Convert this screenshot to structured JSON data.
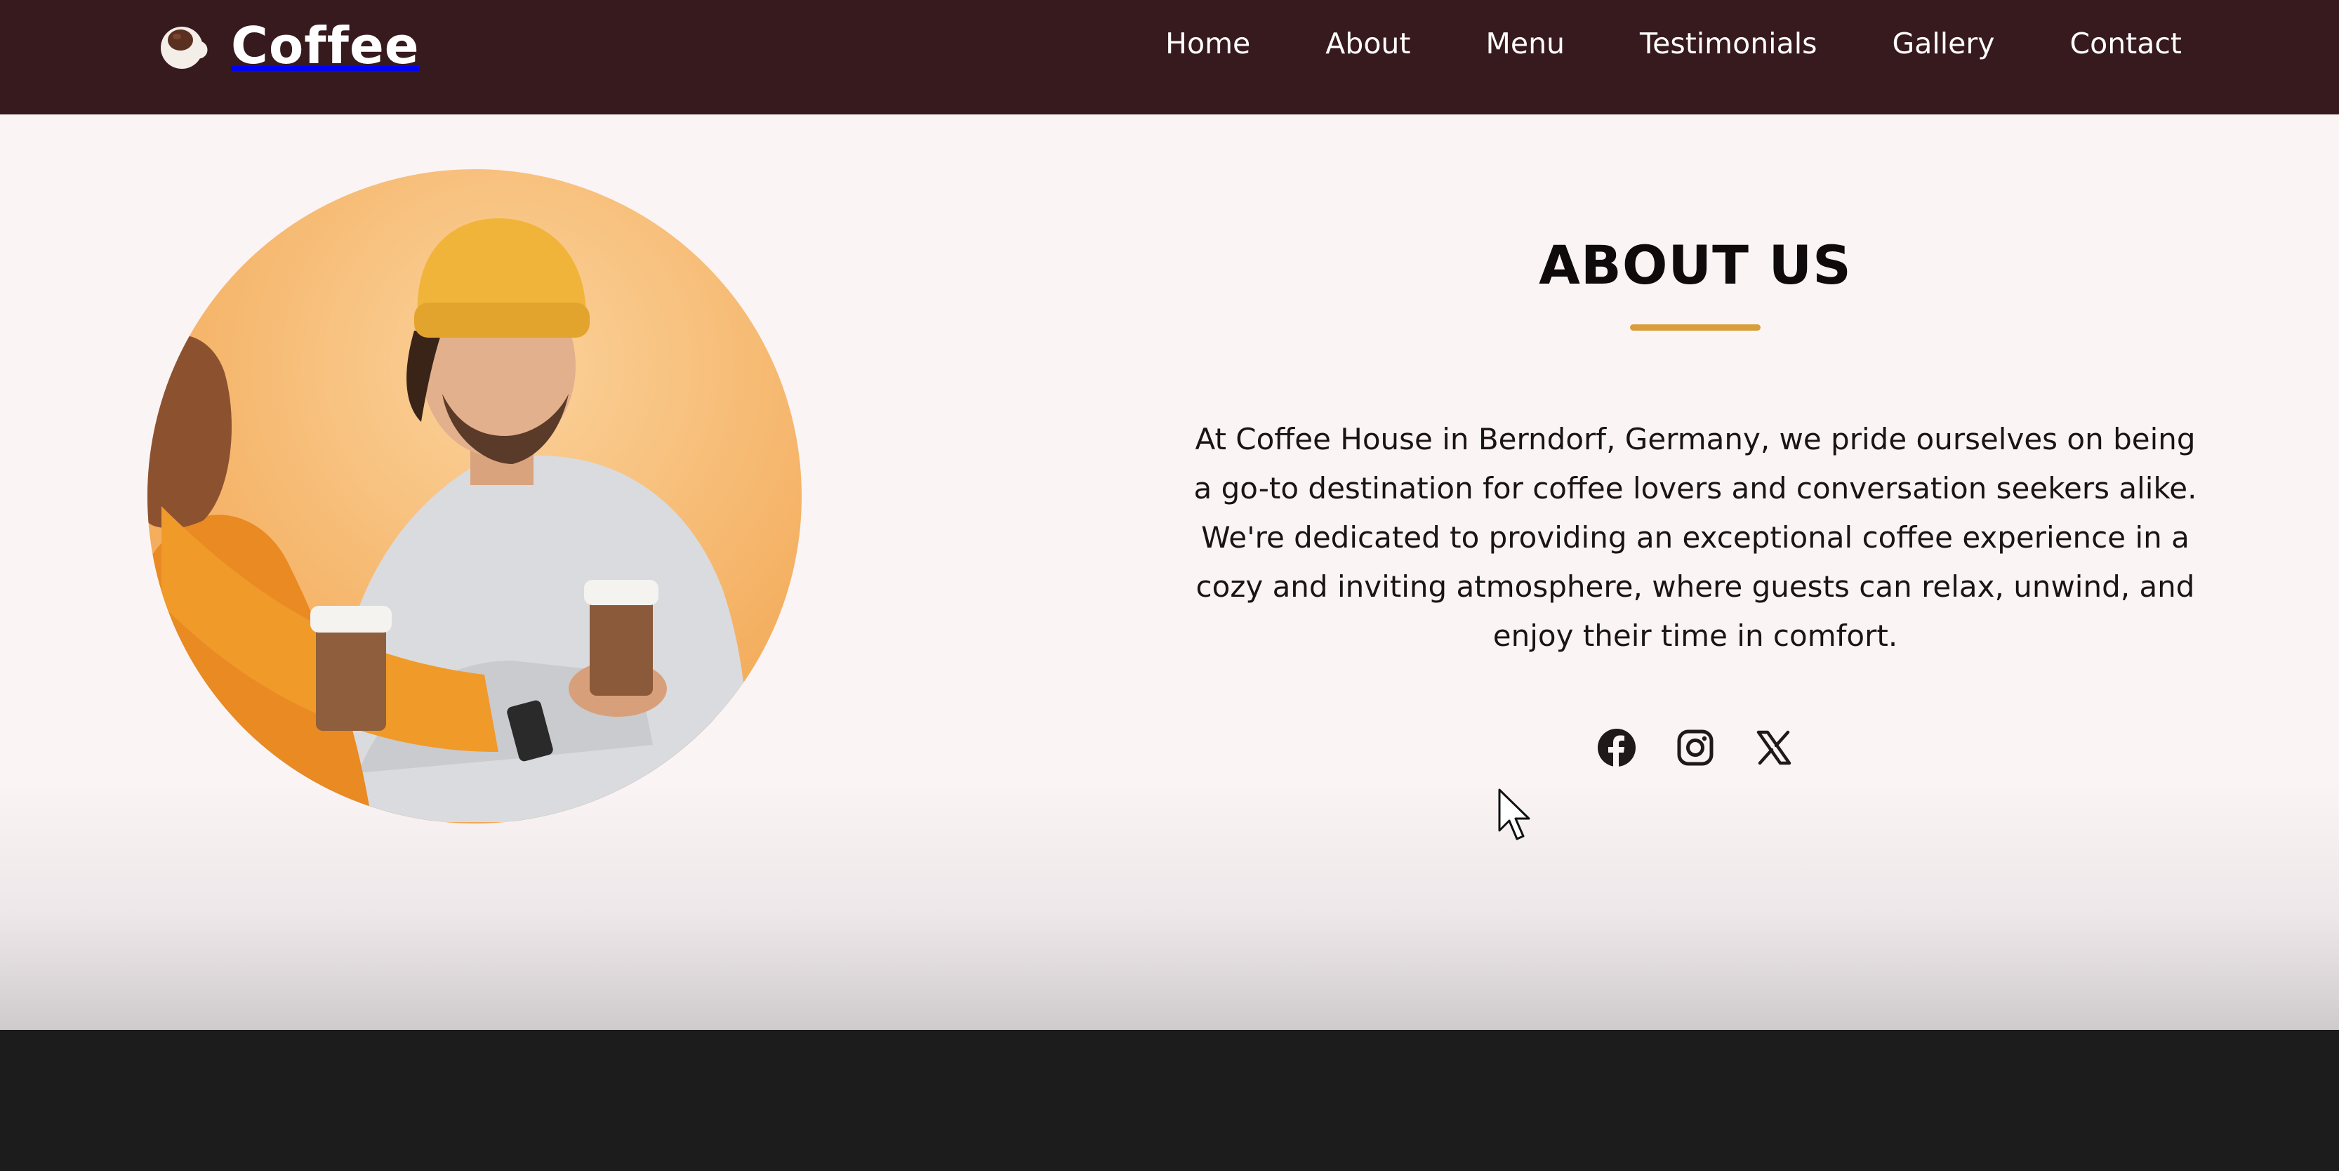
{
  "brand": {
    "name": "Coffee",
    "logo_icon": "coffee-cup-icon"
  },
  "nav": {
    "items": [
      {
        "label": "Home"
      },
      {
        "label": "About"
      },
      {
        "label": "Menu"
      },
      {
        "label": "Testimonials"
      },
      {
        "label": "Gallery"
      },
      {
        "label": "Contact"
      }
    ]
  },
  "about": {
    "title": "ABOUT US",
    "text": "At Coffee House in Berndorf, Germany, we pride ourselves on being a go-to destination for coffee lovers and conversation seekers alike. We're dedicated to providing an exceptional coffee experience in a cozy and inviting atmosphere, where guests can relax, unwind, and enjoy their time in comfort.",
    "image_icon": "couple-drinking-coffee-photo",
    "social": [
      {
        "icon": "facebook-icon"
      },
      {
        "icon": "instagram-icon"
      },
      {
        "icon": "x-twitter-icon"
      }
    ]
  },
  "colors": {
    "navbar_bg": "#371a1e",
    "accent": "#d79e3b",
    "section_bg": "#faf4f5",
    "footer_bg": "#1d1c1d",
    "text": "#1a1415"
  }
}
